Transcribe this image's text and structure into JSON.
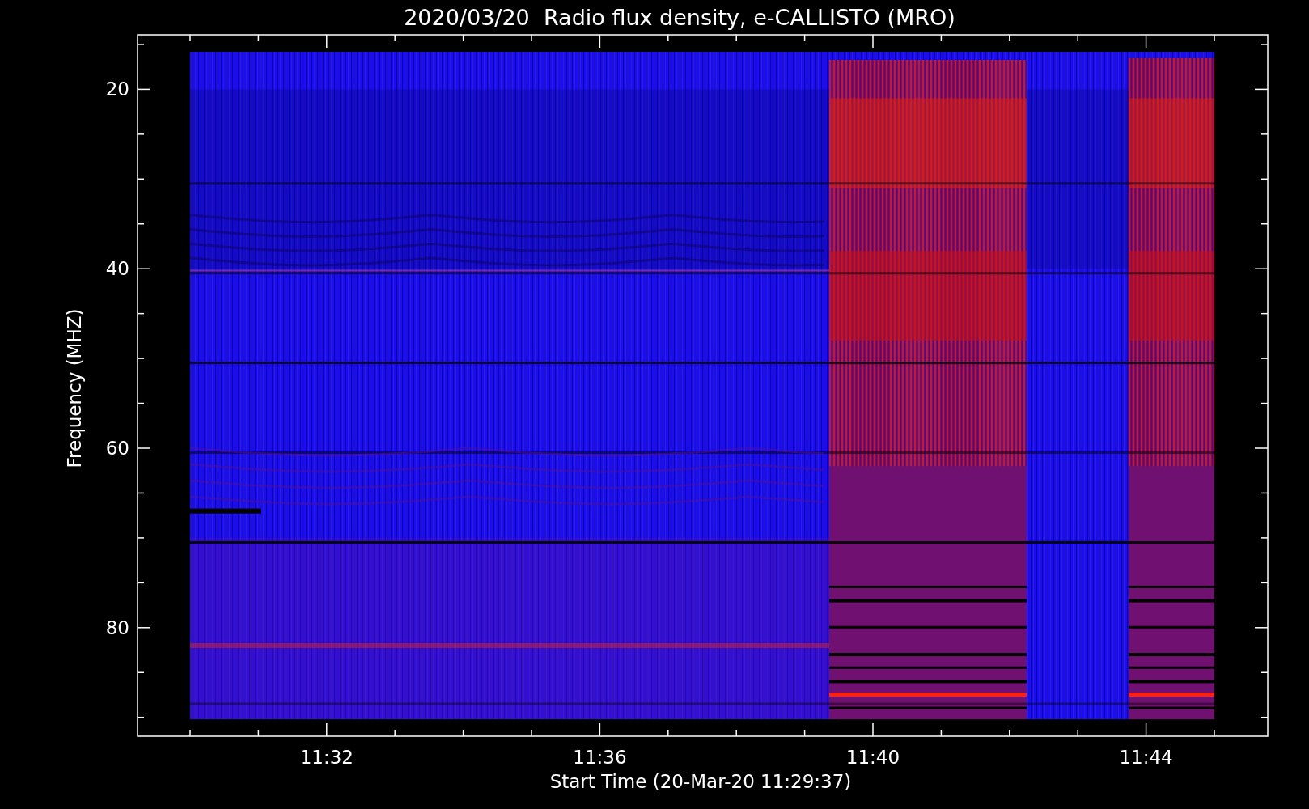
{
  "plot": {
    "title": "2020/03/20  Radio flux density, e-CALLISTO (MRO)",
    "y_axis": {
      "label": "Frequency (MHZ)",
      "ticks": [
        "20",
        "40",
        "60",
        "80"
      ]
    },
    "x_axis": {
      "label": "Start Time (20-Mar-20 11:29:37)",
      "ticks": [
        "11:32",
        "11:36",
        "11:40",
        "11:44"
      ]
    }
  }
}
